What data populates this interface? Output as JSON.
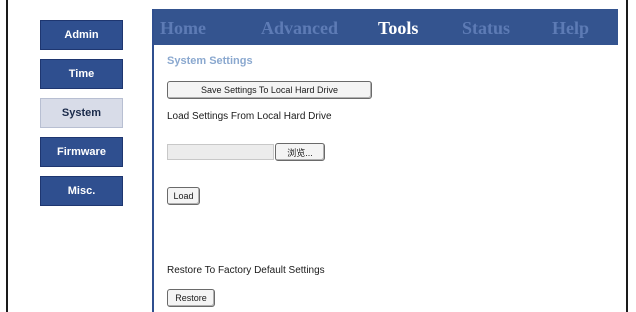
{
  "sidebar": {
    "items": [
      {
        "label": "Admin"
      },
      {
        "label": "Time"
      },
      {
        "label": "System"
      },
      {
        "label": "Firmware"
      },
      {
        "label": "Misc."
      }
    ]
  },
  "nav": {
    "items": [
      {
        "label": "Home"
      },
      {
        "label": "Advanced"
      },
      {
        "label": "Tools"
      },
      {
        "label": "Status"
      },
      {
        "label": "Help"
      }
    ]
  },
  "content": {
    "section_title": "System Settings",
    "save_button": "Save Settings To Local Hard Drive",
    "load_label": "Load Settings From Local Hard Drive",
    "browse_button": "浏览...",
    "load_button": "Load",
    "restore_label": "Restore To Factory Default Settings",
    "restore_button": "Restore"
  },
  "colors": {
    "nav_bg": "#34548f",
    "sidebar_button": "#2f4f8f",
    "sidebar_active": "#d8dce8",
    "section_title": "#8aa8cf"
  }
}
